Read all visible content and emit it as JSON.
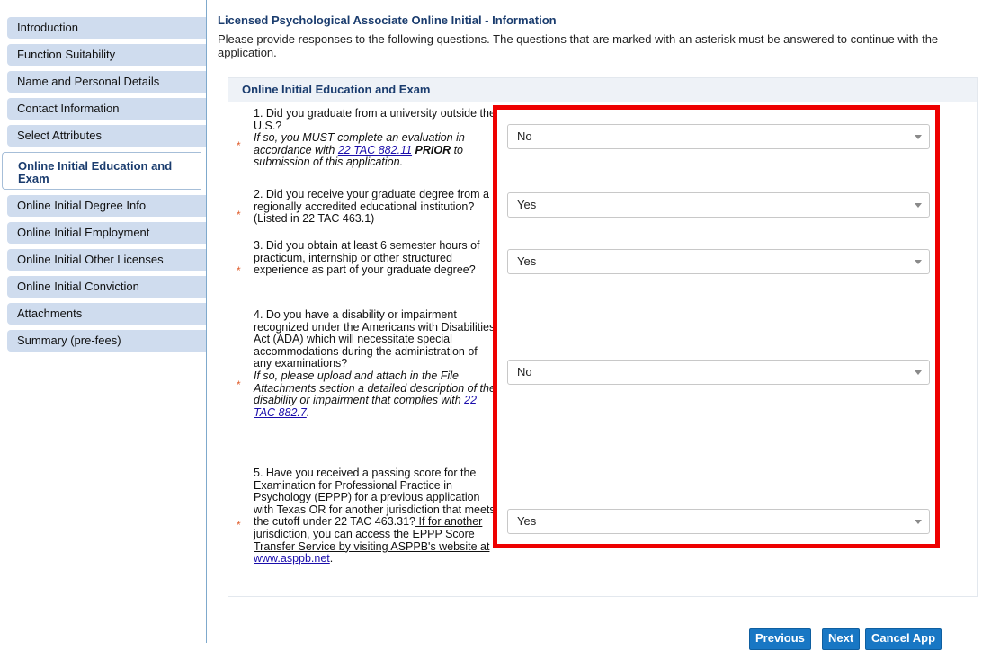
{
  "sidebar": {
    "items": [
      {
        "label": "Introduction"
      },
      {
        "label": "Function Suitability"
      },
      {
        "label": "Name and Personal Details"
      },
      {
        "label": "Contact Information"
      },
      {
        "label": "Select Attributes"
      },
      {
        "label": "Online Initial Education and Exam",
        "active": true
      },
      {
        "label": "Online Initial Degree Info"
      },
      {
        "label": "Online Initial Employment"
      },
      {
        "label": "Online Initial Other Licenses"
      },
      {
        "label": "Online Initial Conviction"
      },
      {
        "label": "Attachments"
      },
      {
        "label": "Summary (pre-fees)"
      }
    ]
  },
  "page": {
    "title": "Licensed Psychological Associate Online Initial - Information",
    "instructions": "Please provide responses to the following questions. The questions that are marked with an asterisk must be answered to continue with the application."
  },
  "panel": {
    "header": "Online Initial Education and Exam",
    "required_marker": "*",
    "questions": [
      {
        "text": "1. Did you graduate from a university outside the U.S.?",
        "note_pre": "If so, you MUST complete an evaluation in accordance with ",
        "note_link": "22 TAC 882.11",
        "note_bold": " PRIOR",
        "note_post": " to submission of this application.",
        "answer": "No"
      },
      {
        "text": "2. Did you receive your graduate degree from a regionally accredited educational institution? (Listed in 22 TAC 463.1)",
        "answer": "Yes"
      },
      {
        "text": "3. Did you obtain at least 6 semester hours of practicum, internship or other structured experience as part of your graduate degree?",
        "answer": "Yes"
      },
      {
        "text": "4. Do you have a disability or impairment recognized under the Americans with Disabilities Act (ADA) which will necessitate special accommodations during the administration of any examinations?",
        "note_pre": "If so, please upload and attach in the File Attachments section a detailed description of the disability or impairment that complies with ",
        "note_link": "22 TAC 882.7",
        "note_post": ".",
        "answer": "No"
      },
      {
        "text": "5. Have you received a passing score for the Examination for Professional Practice in Psychology (EPPP) for a previous application with Texas OR for another jurisdiction that meets the cutoff under 22 TAC 463.31?",
        "underline_text": " If for another jurisdiction, you can access the EPPP Score Transfer Service by visiting ASPPB's website at ",
        "link": "www.asppb.net",
        "post": ".",
        "answer": "Yes"
      }
    ]
  },
  "buttons": {
    "previous": "Previous",
    "next": "Next",
    "cancel": "Cancel App"
  },
  "colors": {
    "highlight": "#ee0000",
    "button": "#1877c4",
    "nav_bg": "#cfdcee",
    "title": "#1a3c6e"
  },
  "icons": {
    "dropdown": "chevron-down-icon"
  }
}
